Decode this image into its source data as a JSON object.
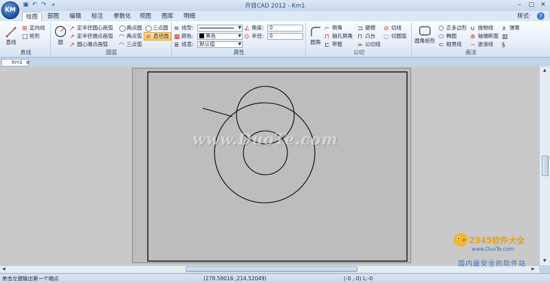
{
  "window": {
    "title": "开目CAD 2012 - Km1",
    "logo_text": "KM",
    "min": "–",
    "max": "▢",
    "close": "✕"
  },
  "qat": [
    "save-icon",
    "undo-icon",
    "redo-icon",
    "dropdown-icon"
  ],
  "menu": {
    "tabs": [
      "绘图",
      "部图",
      "编辑",
      "标注",
      "参数化",
      "视图",
      "图库",
      "明细"
    ],
    "style_label": "样式·",
    "help": "?"
  },
  "ribbon": {
    "line_group": {
      "label": "直线",
      "big": "直线",
      "items": [
        "定向线",
        "矩形"
      ]
    },
    "arc_group": {
      "label": "圆弧",
      "big": "圆",
      "items": [
        "定半径圆心画弧",
        "两点圆",
        "三点圆",
        "定半径端点画弧",
        "两点弧",
        "直径圆",
        "圆心端点画弧",
        "三点弧"
      ]
    },
    "attr_group": {
      "label": "属性",
      "linetype_label": "线型:",
      "color_label": "颜色:",
      "color_value": "黑色",
      "linewidth_label": "线宽:",
      "linewidth_value": "默认值",
      "angle_label": "角度:",
      "angle_value": "0",
      "radius_label": "半径:",
      "radius_value": "0"
    },
    "cw_group": {
      "label": "公切",
      "big": "圆角",
      "items": [
        "倒角",
        "键槽",
        "切线",
        "轴孔倒角",
        "凸台",
        "切圆弧",
        "带整",
        "公切线"
      ]
    },
    "draw_group": {
      "label": "画法",
      "big": "圆角矩形",
      "items": [
        "正多边形",
        "抛物线",
        "弹簧",
        "椭圆",
        "轴端断面",
        "相贯线",
        "波浪线"
      ]
    }
  },
  "doc": {
    "tab": "Km1",
    "close": "✕"
  },
  "watermark": "www.DuoTe.com",
  "status": {
    "message": "单击左键输出第一个端点",
    "coords": "(278.59016 ,214.52049)",
    "relative": "(-0 ,-0) L:-0"
  },
  "overlay": {
    "brand": "2345软件大全",
    "url": "www.DuoTe.com",
    "slogan": "国内最安全的软件站"
  }
}
